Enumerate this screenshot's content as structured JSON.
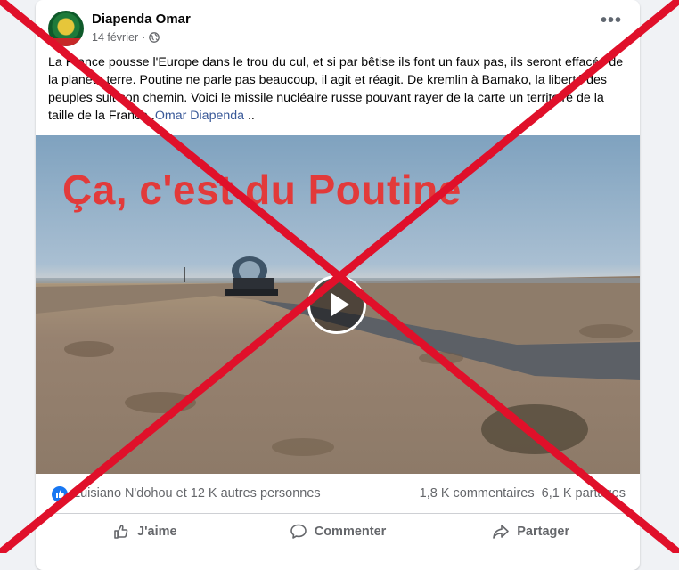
{
  "post": {
    "author": "Diapenda Omar",
    "date": "14 février",
    "text_1": "La France pousse l'Europe dans le trou du cul, et si par bêtise ils font un faux pas, ils seront effacés de la planète terre. Poutine ne parle pas beaucoup, il agit et réagit. De kremlin à Bamako, la liberté des peuples suit son chemin. Voici le missile nucléaire russe pouvant rayer de la carte un territoire de la taille de la France .",
    "tag": "Omar Diapenda",
    "text_2": " .."
  },
  "video": {
    "overlay_text": "Ça, c'est du Poutine"
  },
  "stats": {
    "likers": "Luisiano N'dohou et 12 K autres personnes",
    "comments": "1,8 K commentaires",
    "shares": "6,1 K partages"
  },
  "actions": {
    "like": "J'aime",
    "comment": "Commenter",
    "share": "Partager"
  },
  "icons": [
    "globe-icon",
    "more-icon",
    "play-icon",
    "like-reaction-icon",
    "thumbs-up-icon",
    "comment-icon",
    "share-icon"
  ],
  "colors": {
    "facebook_blue": "#1877f2",
    "overlay_cross_red": "#e0102a",
    "video_title_red": "#e23a3a"
  }
}
